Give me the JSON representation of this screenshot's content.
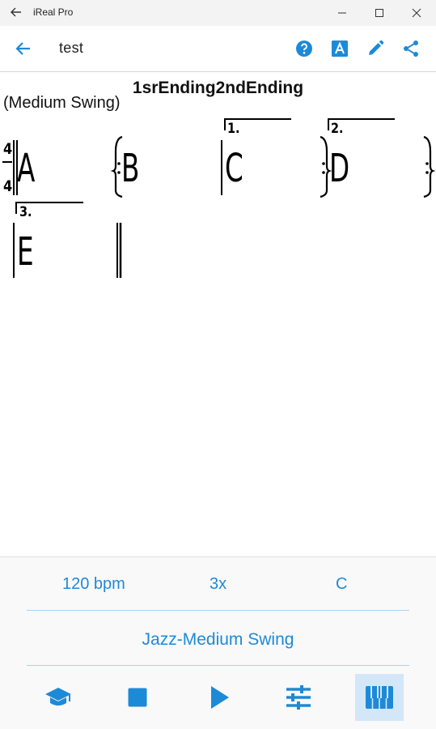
{
  "window": {
    "title": "iReal Pro"
  },
  "app_bar": {
    "title": "test"
  },
  "sheet": {
    "song_title": "1srEnding2ndEnding",
    "style_label": "(Medium Swing)",
    "time_signature": {
      "top": "4",
      "bottom": "4"
    },
    "measures": [
      {
        "chord": "A"
      },
      {
        "chord": "B"
      },
      {
        "chord": "C",
        "ending": "1."
      },
      {
        "chord": "D",
        "ending": "2."
      },
      {
        "chord": "E",
        "ending": "3."
      }
    ]
  },
  "player": {
    "tempo": "120 bpm",
    "repeats": "3x",
    "key": "C",
    "style": "Jazz-Medium Swing"
  },
  "colors": {
    "accent": "#1d8ad8",
    "active_bg": "#d3e7f8"
  }
}
